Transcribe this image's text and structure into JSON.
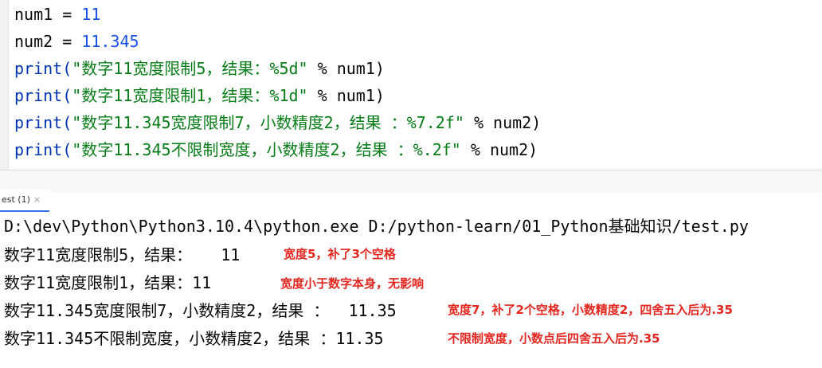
{
  "editor": {
    "lines": [
      {
        "a": "num1 = ",
        "b": "11"
      },
      {
        "a": "num2 = ",
        "b": "11.345"
      },
      {
        "fn": "print(",
        "str": "\"数字11宽度限制5，结果：%5d\"",
        "rest": " % num1)"
      },
      {
        "fn": "print(",
        "str": "\"数字11宽度限制1，结果：%1d\"",
        "rest": " % num1)"
      },
      {
        "fn": "print(",
        "str": "\"数字11.345宽度限制7，小数精度2，结果 ：%7.2f\"",
        "rest": " % num2)"
      },
      {
        "fn": "print(",
        "str": "\"数字11.345不限制宽度，小数精度2，结果 ：%.2f\"",
        "rest": " % num2)"
      }
    ]
  },
  "run_tab": {
    "label": "est (1)",
    "close": "×"
  },
  "console": {
    "command": "D:\\dev\\Python\\Python3.10.4\\python.exe D:/python-learn/01_Python基础知识/test.py",
    "outputs": [
      "数字11宽度限制5，结果：   11",
      "数字11宽度限制1，结果：11",
      "数字11.345宽度限制7，小数精度2，结果 ：  11.35",
      "数字11.345不限制宽度，小数精度2，结果 ：11.35"
    ]
  },
  "annotations": [
    "宽度5，补了3个空格",
    "宽度小于数字本身，无影响",
    "宽度7，补了2个空格，小数精度2，四舍五入后为.35",
    "不限制宽度，小数点后四舍五入后为.35"
  ],
  "colors": {
    "annotation": "#e5261f",
    "string": "#067d17",
    "number": "#1750eb",
    "keyword": "#0033b3"
  }
}
